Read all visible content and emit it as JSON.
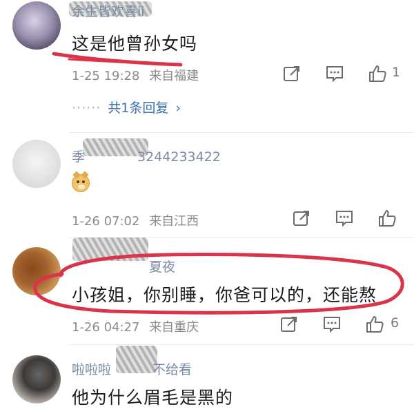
{
  "comments": [
    {
      "username": "余生皆欢喜ii",
      "text": "这是他曾孙女吗",
      "time": "1-25 19:28",
      "location": "来自福建",
      "like_count": "1",
      "replies_dots": "······",
      "replies_label": "共1条回复",
      "replies_chevron": "›"
    },
    {
      "username": "季",
      "username_suffix": "3244233422",
      "emoji_icon": "doge-emoji-icon",
      "time": "1-26 07:02",
      "location": "来自江西",
      "like_count": ""
    },
    {
      "username": "夏夜",
      "text": "小孩姐，你别睡，你爸可以的，还能熬",
      "time": "1-26 04:27",
      "location": "来自重庆",
      "like_count": "6"
    },
    {
      "username": "啦啦啦",
      "username_suffix": "不给看",
      "text": "他为什么眉毛是黑的"
    }
  ],
  "icons": {
    "share": "share-icon",
    "comment": "comment-icon",
    "like": "thumbs-up-icon"
  },
  "colors": {
    "annotation_red": "#d8344a",
    "username": "#7a8aa3",
    "reply_link": "#3a6ea8"
  }
}
